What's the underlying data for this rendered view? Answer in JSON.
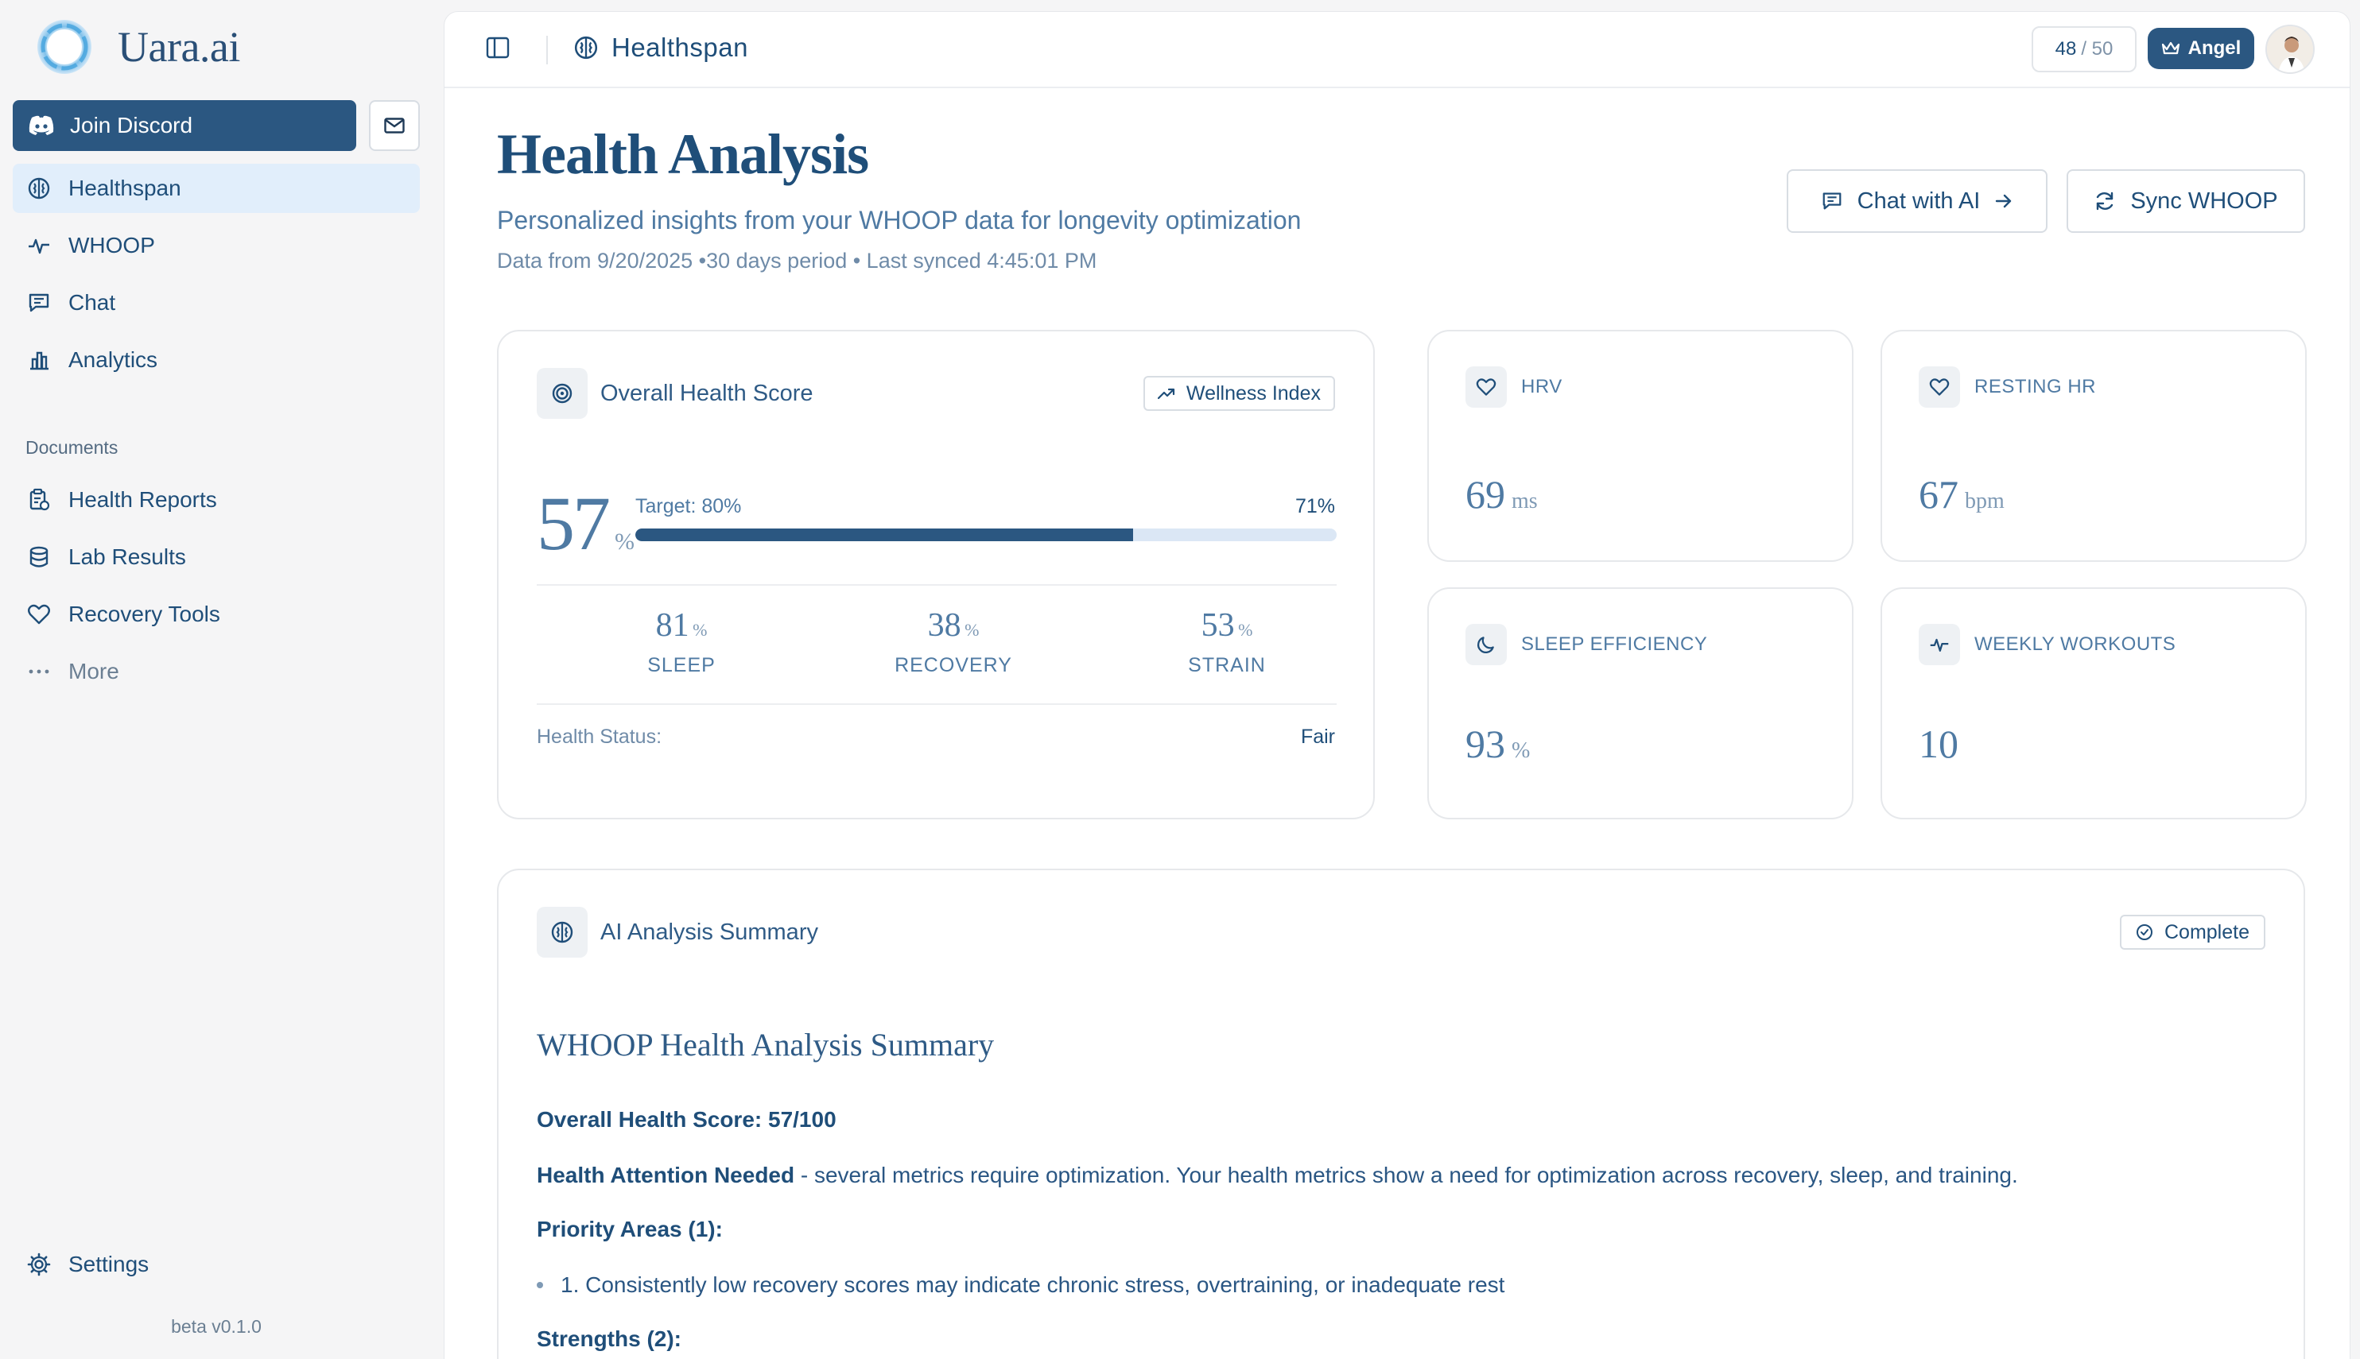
{
  "brand": {
    "name": "Uara.ai"
  },
  "sidebar": {
    "join_discord": "Join Discord",
    "items": [
      {
        "label": "Healthspan",
        "icon": "brain-icon"
      },
      {
        "label": "WHOOP",
        "icon": "activity-icon"
      },
      {
        "label": "Chat",
        "icon": "chat-icon"
      },
      {
        "label": "Analytics",
        "icon": "bar-chart-icon"
      }
    ],
    "documents_heading": "Documents",
    "documents": [
      {
        "label": "Health Reports",
        "icon": "clipboard-icon"
      },
      {
        "label": "Lab Results",
        "icon": "database-icon"
      },
      {
        "label": "Recovery Tools",
        "icon": "heart-icon"
      },
      {
        "label": "More",
        "icon": "more-icon"
      }
    ],
    "settings": "Settings",
    "version": "beta v0.1.0"
  },
  "topbar": {
    "breadcrumb": "Healthspan",
    "credits_used": "48",
    "credits_max": "/ 50",
    "plan": "Angel"
  },
  "header": {
    "title": "Health Analysis",
    "subtitle": "Personalized insights from your WHOOP data for longevity optimization",
    "meta": "Data from 9/20/2025 •30 days period  • Last synced 4:45:01 PM",
    "chat_button": "Chat with AI",
    "sync_button": "Sync WHOOP"
  },
  "score_card": {
    "title": "Overall Health Score",
    "badge": "Wellness Index",
    "score": "57",
    "score_unit": "%",
    "target_label": "Target: 80%",
    "progress_label": "71%",
    "progress_fraction": 0.71,
    "sub_metrics": [
      {
        "value": "81",
        "unit": "%",
        "label": "SLEEP"
      },
      {
        "value": "38",
        "unit": "%",
        "label": "RECOVERY"
      },
      {
        "value": "53",
        "unit": "%",
        "label": "STRAIN"
      }
    ],
    "status_label": "Health Status:",
    "status_value": "Fair"
  },
  "metrics": [
    {
      "label": "HRV",
      "value": "69",
      "unit": "ms",
      "icon": "heart-icon"
    },
    {
      "label": "RESTING HR",
      "value": "67",
      "unit": "bpm",
      "icon": "heart-icon"
    },
    {
      "label": "SLEEP EFFICIENCY",
      "value": "93",
      "unit": "%",
      "icon": "moon-icon"
    },
    {
      "label": "WEEKLY WORKOUTS",
      "value": "10",
      "unit": "",
      "icon": "activity-icon"
    }
  ],
  "summary": {
    "title": "AI Analysis Summary",
    "status": "Complete",
    "heading": "WHOOP Health Analysis Summary",
    "overall": "Overall Health Score: 57/100",
    "attention_bold": "Health Attention Needed",
    "attention_text": " - several metrics require optimization. Your health metrics show a need for optimization across recovery, sleep, and training.",
    "priority_heading": "Priority Areas (1):",
    "priority_items": [
      "1. Consistently low recovery scores may indicate chronic stress, overtraining, or inadequate rest"
    ],
    "strengths_heading": "Strengths (2):"
  },
  "colors": {
    "primary": "#2b5781",
    "text": "#1f4e79",
    "muted": "#4f7aa3",
    "active_nav": "#e1eefb",
    "bar_track": "#dbe7f5"
  }
}
